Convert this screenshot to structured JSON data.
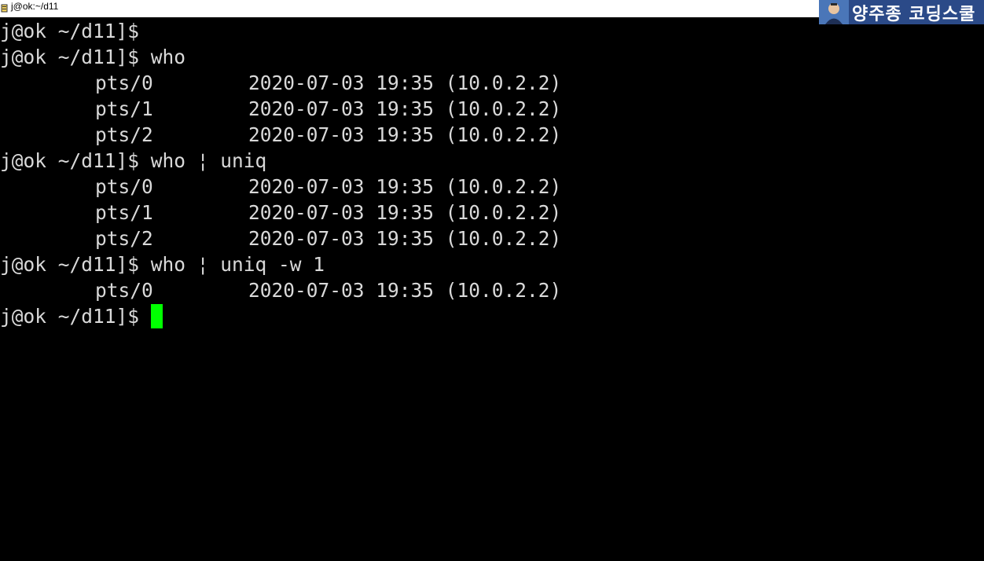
{
  "window": {
    "title": "j@ok:~/d11"
  },
  "badge": {
    "text": "양주종 코딩스쿨"
  },
  "terminal": {
    "prompt": "j@ok ~/d11]$",
    "blocks": [
      {
        "command": "",
        "output": []
      },
      {
        "command": "who",
        "output": [
          {
            "tty": "pts/0",
            "info": "2020-07-03 19:35 (10.0.2.2)"
          },
          {
            "tty": "pts/1",
            "info": "2020-07-03 19:35 (10.0.2.2)"
          },
          {
            "tty": "pts/2",
            "info": "2020-07-03 19:35 (10.0.2.2)"
          }
        ]
      },
      {
        "command": "who ¦ uniq",
        "output": [
          {
            "tty": "pts/0",
            "info": "2020-07-03 19:35 (10.0.2.2)"
          },
          {
            "tty": "pts/1",
            "info": "2020-07-03 19:35 (10.0.2.2)"
          },
          {
            "tty": "pts/2",
            "info": "2020-07-03 19:35 (10.0.2.2)"
          }
        ]
      },
      {
        "command": "who ¦ uniq -w 1",
        "output": [
          {
            "tty": "pts/0",
            "info": "2020-07-03 19:35 (10.0.2.2)"
          }
        ]
      },
      {
        "command": "",
        "output": []
      }
    ],
    "cursor_color": "#00ff00",
    "background": "#000000",
    "foreground": "#d9d9d9"
  }
}
